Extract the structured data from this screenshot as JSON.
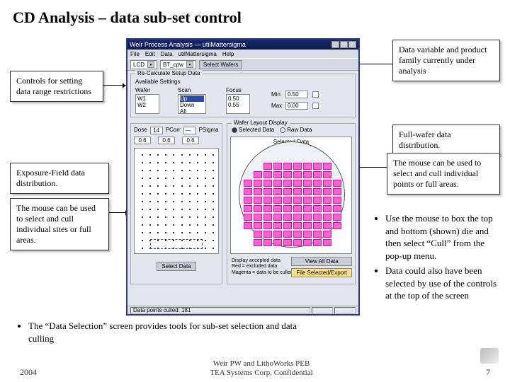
{
  "title": "CD Analysis – data sub-set control",
  "callouts": {
    "controls": "Controls for setting data range restrictions",
    "data_var": "Data variable and product family currently under analysis",
    "full_wafer": "Full-wafer data distribution.",
    "wafer_mouse": "The mouse can be used to select and cull individual points or full areas.",
    "exp_field": "Exposure-Field data distribution.",
    "exp_mouse": "The mouse can be used to select and cull individual sites or full areas."
  },
  "bullets_right": [
    "Use the mouse to box the top and bottom (shown) die and then select “Cull” from the pop-up menu.",
    "Data could also have been selected by use of the controls at the top of the screen"
  ],
  "bullet_bottom": "The “Data Selection” screen provides tools for sub-set selection and data culling",
  "footer": {
    "year": "2004",
    "center1": "Weir PW and LithoWorks PEB",
    "center2": "TEA Systems Corp. Confidential",
    "page": "7"
  },
  "app": {
    "title": "Weir Process Analysis — utilMattersigma",
    "menu": [
      "File",
      "Edit",
      "Data",
      "utilMattersigma",
      "Help"
    ],
    "dropdowns": {
      "var": "LCD",
      "family": "BT_cpw"
    },
    "tb_btn": "Select Wafers",
    "setup": {
      "group": "Re-Calculate Setup Data",
      "sub": "Available Settings",
      "wafer_lbl": "Wafer",
      "scan_lbl": "Scan",
      "focus_lbl": "Focus",
      "wafer_list": [
        "W1",
        "W2"
      ],
      "scan_list": [
        "Up",
        "Down",
        "All"
      ],
      "focus_vals": [
        "0.50",
        "0.55"
      ],
      "min_lbl": "Min",
      "max_lbl": "Max",
      "min_val": "0.50",
      "max_val": "0.00"
    },
    "left": {
      "stats": {
        "dose_lbl": "Dose",
        "dose_val": "14",
        "pc_lbl": "PCorr",
        "pc_val": "—",
        "ps_lbl": "PSigma",
        "ps_val": "—"
      },
      "row2": {
        "a": "0.6",
        "b": "0.6",
        "c": "0.6"
      },
      "btn": "Select Data"
    },
    "right": {
      "group": "Wafer Layout Display",
      "radio": {
        "sel": "Selected Data",
        "raw": "Raw Data"
      },
      "heading": "Selected Data",
      "legend": {
        "l1": "Display accepted data",
        "l2": "Red = excluded data",
        "l3": "Magenta = data to be culled"
      },
      "btns": {
        "all": "View All Data",
        "export": "File Selected/Export"
      }
    },
    "status": "Data points culled: 181"
  }
}
